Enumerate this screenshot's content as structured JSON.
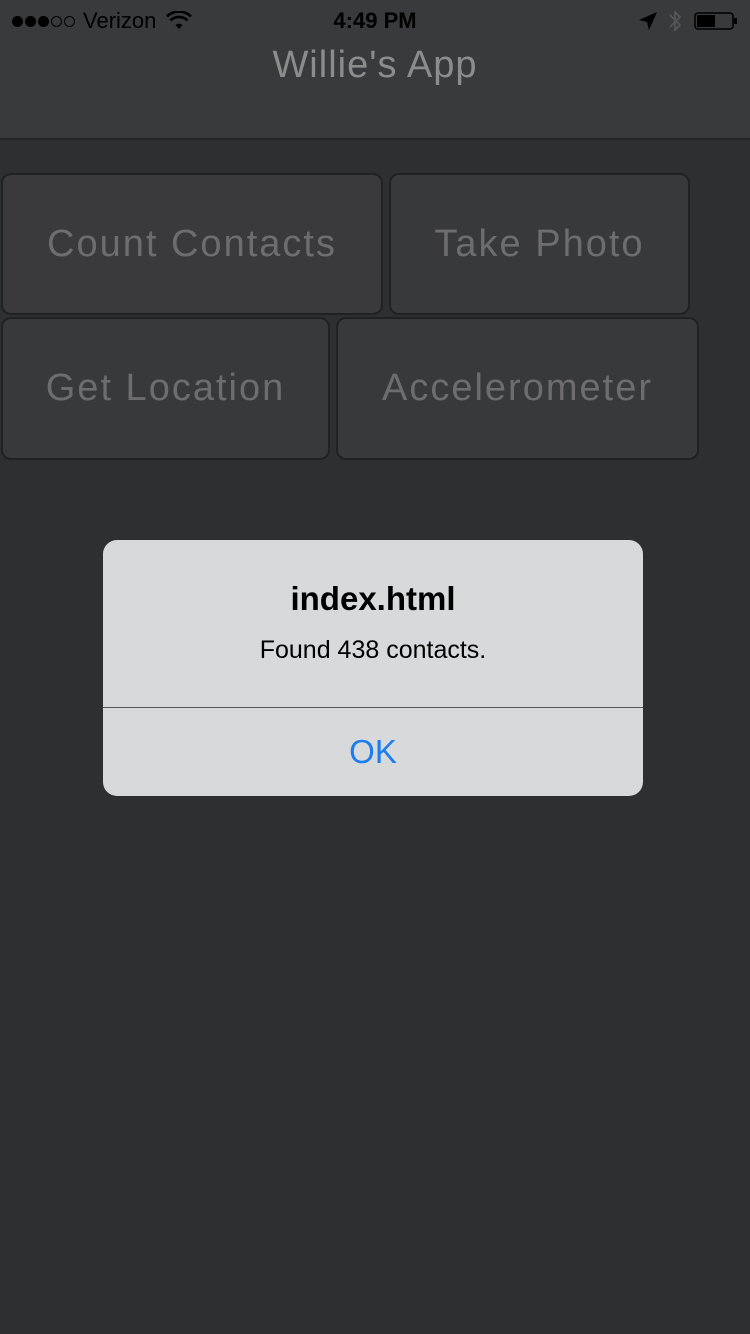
{
  "status_bar": {
    "carrier": "Verizon",
    "time": "4:49 PM",
    "signal_filled": 3,
    "signal_total": 5,
    "icons": [
      "wifi-icon",
      "location-arrow-icon",
      "bluetooth-icon",
      "battery-icon"
    ]
  },
  "nav": {
    "title": "Willie's App"
  },
  "buttons": {
    "count_contacts": "Count Contacts",
    "take_photo": "Take Photo",
    "get_location": "Get Location",
    "accelerometer": "Accelerometer"
  },
  "alert": {
    "title": "index.html",
    "message": "Found 438 contacts.",
    "ok_label": "OK"
  },
  "colors": {
    "background": "#2e2f31",
    "alert_background": "#d8d9da",
    "alert_button": "#1a7df0",
    "button_text": "#6d6d6e"
  }
}
